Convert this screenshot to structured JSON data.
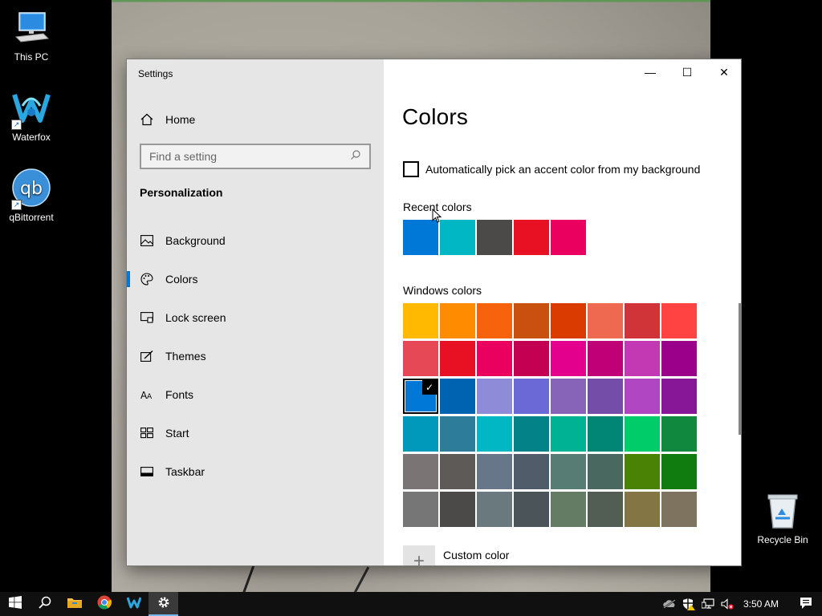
{
  "desktop": {
    "icons": [
      {
        "label": "This PC",
        "icon": "this-pc-icon"
      },
      {
        "label": "Waterfox",
        "icon": "waterfox-icon"
      },
      {
        "label": "qBittorrent",
        "icon": "qbittorrent-icon"
      },
      {
        "label": "Recycle Bin",
        "icon": "recycle-bin-icon"
      }
    ]
  },
  "window": {
    "title": "Settings",
    "caption": {
      "minimize": "—",
      "maximize": "☐",
      "close": "✕"
    }
  },
  "sidebar": {
    "home": "Home",
    "search": {
      "placeholder": "Find a setting",
      "value": ""
    },
    "section": "Personalization",
    "items": [
      {
        "label": "Background",
        "icon": "picture-icon",
        "active": false
      },
      {
        "label": "Colors",
        "icon": "palette-icon",
        "active": true
      },
      {
        "label": "Lock screen",
        "icon": "lock-screen-icon",
        "active": false
      },
      {
        "label": "Themes",
        "icon": "brush-icon",
        "active": false
      },
      {
        "label": "Fonts",
        "icon": "fonts-icon",
        "active": false
      },
      {
        "label": "Start",
        "icon": "start-layout-icon",
        "active": false
      },
      {
        "label": "Taskbar",
        "icon": "taskbar-icon",
        "active": false
      }
    ]
  },
  "main": {
    "title": "Colors",
    "auto_pick_label": "Automatically pick an accent color from my background",
    "auto_pick_checked": false,
    "recent_label": "Recent colors",
    "recent_colors": [
      "#0078D7",
      "#00B7C3",
      "#4C4A48",
      "#E81123",
      "#EA005E"
    ],
    "windows_label": "Windows colors",
    "windows_colors": [
      [
        "#FFB900",
        "#FF8C00",
        "#F7630C",
        "#CA5010",
        "#DA3B01",
        "#EF6950",
        "#D13438",
        "#FF4343"
      ],
      [
        "#E74856",
        "#E81123",
        "#EA005E",
        "#C30052",
        "#E3008C",
        "#BF0077",
        "#C239B3",
        "#9A0089"
      ],
      [
        "#0078D7",
        "#0063B1",
        "#8E8CD8",
        "#6B69D6",
        "#8764B8",
        "#744DA9",
        "#B146C2",
        "#881798"
      ],
      [
        "#0099BC",
        "#2D7D9A",
        "#00B7C3",
        "#038387",
        "#00B294",
        "#018574",
        "#00CC6A",
        "#10893E"
      ],
      [
        "#7A7574",
        "#5D5A58",
        "#68768A",
        "#515C6B",
        "#567C73",
        "#486860",
        "#498205",
        "#107C10"
      ],
      [
        "#767676",
        "#4C4A48",
        "#69797E",
        "#4A5459",
        "#647C64",
        "#525E54",
        "#847545",
        "#7E735F"
      ]
    ],
    "selected_color": "#0078D7",
    "custom_label": "Custom color"
  },
  "taskbar": {
    "pinned": [
      {
        "name": "start-button",
        "icon": "windows-logo-icon"
      },
      {
        "name": "search-button",
        "icon": "search-icon"
      },
      {
        "name": "file-explorer-button",
        "icon": "folder-icon"
      },
      {
        "name": "chrome-button",
        "icon": "chrome-icon"
      },
      {
        "name": "waterfox-button",
        "icon": "waterfox-icon"
      },
      {
        "name": "settings-button",
        "icon": "gear-icon",
        "active": true
      }
    ],
    "clock": "3:50 AM"
  },
  "colors": {
    "accent": "#0078D7",
    "sidebar_bg": "#E6E6E6",
    "taskbar_bg": "#101010"
  }
}
